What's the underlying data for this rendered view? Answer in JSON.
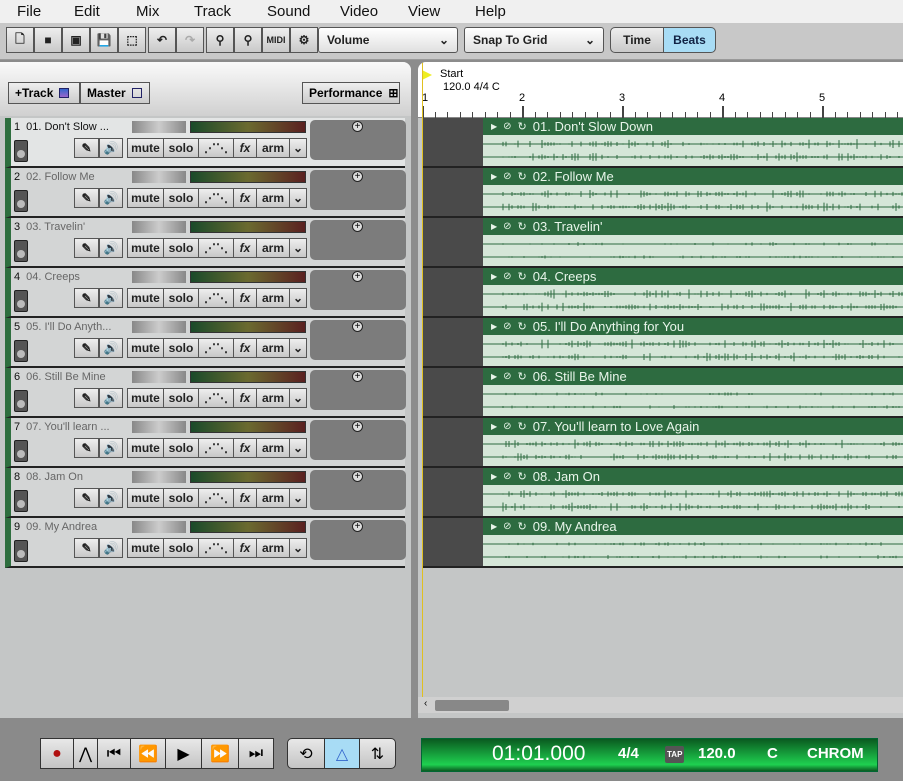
{
  "menu": [
    "File",
    "Edit",
    "Mix",
    "Track",
    "Sound",
    "Video",
    "View",
    "Help"
  ],
  "toolbar": {
    "icons": [
      "new-file",
      "open-folder",
      "open-project",
      "save",
      "select",
      "undo",
      "redo",
      "zoom-in",
      "zoom-out",
      "midi",
      "settings"
    ],
    "midi_label": "MIDI",
    "automation_select": "Volume",
    "snap_select": "Snap To Grid",
    "time_label": "Time",
    "beats_label": "Beats",
    "active": "Beats",
    "accent": "#a8dcf5"
  },
  "left_header": {
    "add_track": "+Track",
    "master": "Master",
    "performance": "Performance"
  },
  "track_buttons": {
    "mute": "mute",
    "solo": "solo",
    "fx": "fx",
    "arm": "arm"
  },
  "tracks": [
    {
      "num": "1",
      "name": "01. Don't Slow ...",
      "clip": "01. Don't Slow Down",
      "active": true
    },
    {
      "num": "2",
      "name": "02. Follow Me",
      "clip": "02. Follow Me"
    },
    {
      "num": "3",
      "name": "03. Travelin'",
      "clip": "03. Travelin'"
    },
    {
      "num": "4",
      "name": "04. Creeps",
      "clip": "04. Creeps"
    },
    {
      "num": "5",
      "name": "05. I'll Do Anyth...",
      "clip": "05. I'll Do Anything for You"
    },
    {
      "num": "6",
      "name": "06. Still Be Mine",
      "clip": "06. Still Be Mine"
    },
    {
      "num": "7",
      "name": "07. You'll learn ...",
      "clip": "07. You'll learn to Love Again"
    },
    {
      "num": "8",
      "name": "08. Jam On",
      "clip": "08. Jam On"
    },
    {
      "num": "9",
      "name": "09. My Andrea",
      "clip": "09. My Andrea"
    }
  ],
  "ruler": {
    "marker": "Start",
    "tempo_info": "120.0 4/4 C",
    "bars": [
      "1",
      "2",
      "3",
      "4",
      "5"
    ]
  },
  "transport": {
    "time": "01:01.000",
    "signature": "4/4",
    "tap": "TAP",
    "tempo": "120.0",
    "key": "C",
    "scale": "CHROM"
  },
  "colors": {
    "track_green": "#2d6b40",
    "clip_bg": "#d5e6d8",
    "lcd_green": "#1fd050"
  }
}
